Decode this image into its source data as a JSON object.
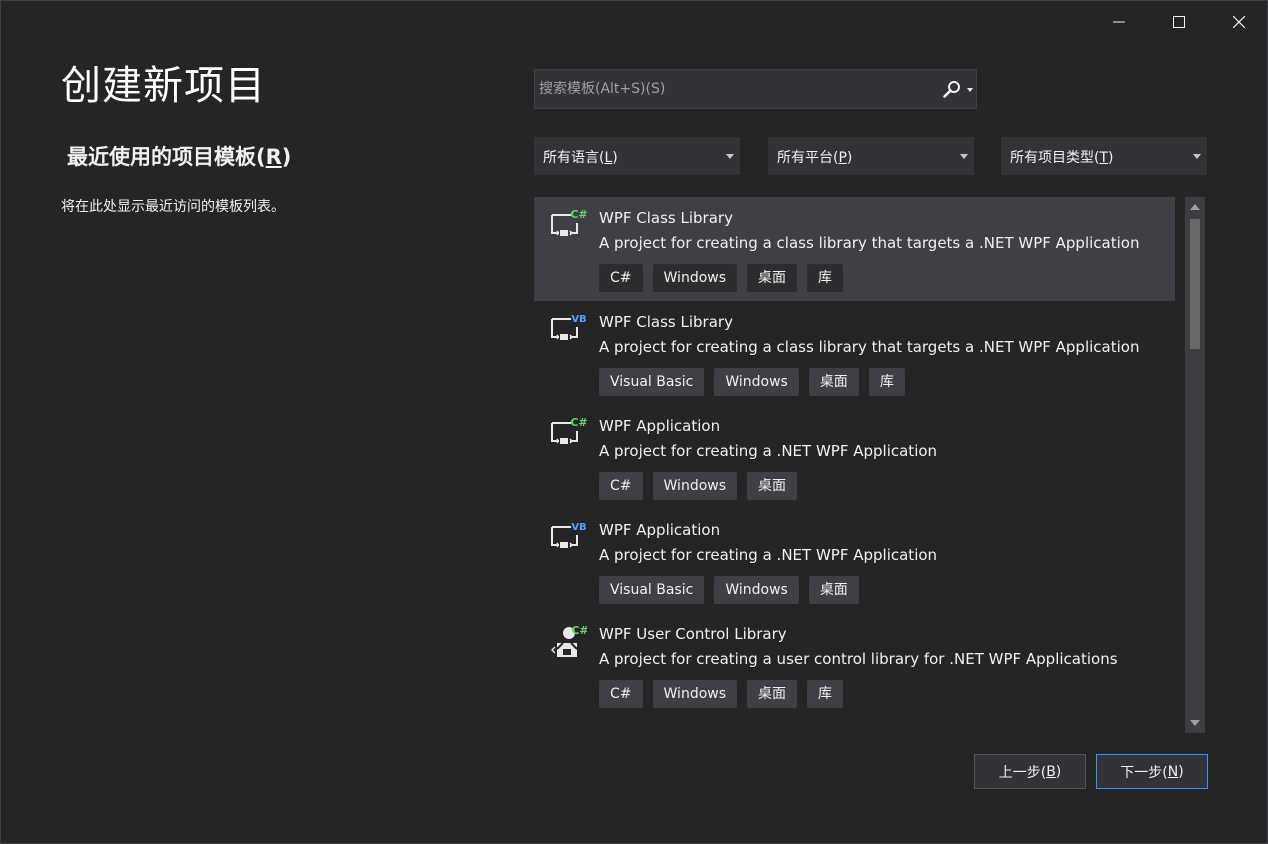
{
  "title": "创建新项目",
  "recent": {
    "title_main": "最近使用的项目模板(",
    "title_key": "R",
    "title_end": ")",
    "empty_text": "将在此处显示最近访问的模板列表。"
  },
  "search": {
    "placeholder": "搜索模板(Alt+S)(S)",
    "icon": "search-icon"
  },
  "filters": [
    {
      "main": "所有语言(",
      "key": "L",
      "end": ")"
    },
    {
      "main": "所有平台(",
      "key": "P",
      "end": ")"
    },
    {
      "main": "所有项目类型(",
      "key": "T",
      "end": ")"
    }
  ],
  "templates": [
    {
      "name": "WPF Class Library",
      "description": "A project for creating a class library that targets a .NET WPF Application",
      "badge": "C#",
      "tags": [
        "C#",
        "Windows",
        "桌面",
        "库"
      ]
    },
    {
      "name": "WPF Class Library",
      "description": "A project for creating a class library that targets a .NET WPF Application",
      "badge": "VB",
      "tags": [
        "Visual Basic",
        "Windows",
        "桌面",
        "库"
      ]
    },
    {
      "name": "WPF Application",
      "description": "A project for creating a .NET WPF Application",
      "badge": "C#",
      "tags": [
        "C#",
        "Windows",
        "桌面"
      ]
    },
    {
      "name": "WPF Application",
      "description": "A project for creating a .NET WPF Application",
      "badge": "VB",
      "tags": [
        "Visual Basic",
        "Windows",
        "桌面"
      ]
    },
    {
      "name": "WPF User Control Library",
      "description": "A project for creating a user control library for .NET WPF Applications",
      "badge": "C#",
      "tags": [
        "C#",
        "Windows",
        "桌面",
        "库"
      ]
    }
  ],
  "buttons": {
    "back_main": "上一步(",
    "back_key": "B",
    "back_end": ")",
    "next_main": "下一步(",
    "next_key": "N",
    "next_end": ")"
  },
  "colors": {
    "background": "#252526",
    "selected_row": "#3f3f46",
    "accent": "#3794ff",
    "csharp_badge": "#6cd26c",
    "vb_badge": "#4da6ff"
  }
}
